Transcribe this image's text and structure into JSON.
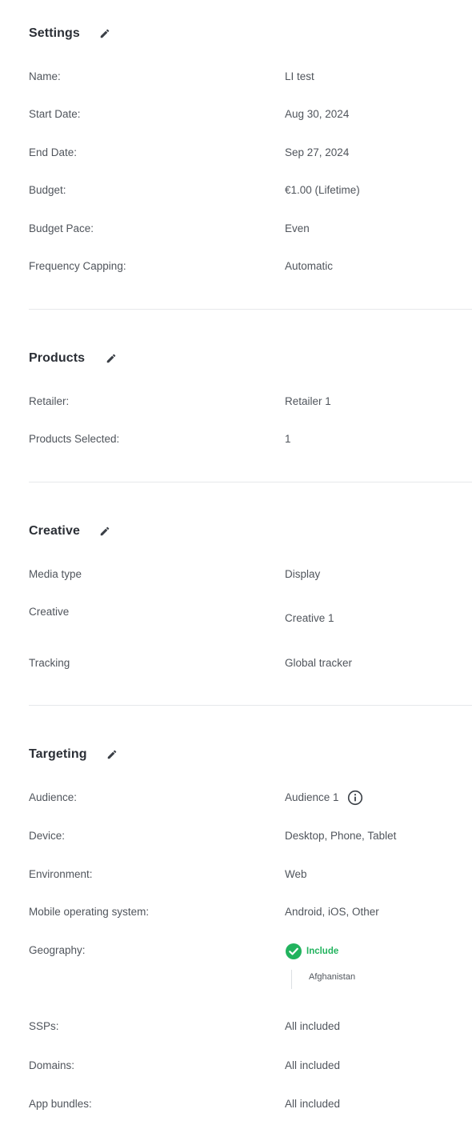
{
  "settings": {
    "title": "Settings",
    "rows": [
      {
        "label": "Name:",
        "value": "LI test"
      },
      {
        "label": "Start Date:",
        "value": "Aug 30, 2024"
      },
      {
        "label": "End Date:",
        "value": "Sep 27, 2024"
      },
      {
        "label": "Budget:",
        "value": "€1.00 (Lifetime)"
      },
      {
        "label": "Budget Pace:",
        "value": "Even"
      },
      {
        "label": "Frequency Capping:",
        "value": "Automatic"
      }
    ]
  },
  "products": {
    "title": "Products",
    "rows": [
      {
        "label": "Retailer:",
        "value": "Retailer 1"
      },
      {
        "label": "Products Selected:",
        "value": "1"
      }
    ]
  },
  "creative": {
    "title": "Creative",
    "rows": [
      {
        "label": "Media type",
        "value": "Display"
      },
      {
        "label": "Creative",
        "value": "Creative 1"
      },
      {
        "label": "Tracking",
        "value": "Global tracker"
      }
    ]
  },
  "targeting": {
    "title": "Targeting",
    "rows": [
      {
        "label": "Audience:",
        "value": "Audience 1"
      },
      {
        "label": "Device:",
        "value": "Desktop, Phone, Tablet"
      },
      {
        "label": "Environment:",
        "value": "Web"
      },
      {
        "label": "Mobile operating system:",
        "value": "Android, iOS, Other"
      },
      {
        "label": "Geography:",
        "value": ""
      },
      {
        "label": "SSPs:",
        "value": "All included"
      },
      {
        "label": "Domains:",
        "value": "All included"
      },
      {
        "label": "App bundles:",
        "value": "All included"
      }
    ],
    "geography": {
      "include_label": "Include",
      "countries": [
        "Afghanistan"
      ]
    }
  },
  "icons": {
    "edit": "pencil-icon",
    "info": "info-circle-icon",
    "include": "check-circle-icon"
  },
  "colors": {
    "include_green": "#22b35e",
    "divider": "#e6e8eb",
    "heading": "#2b2f36"
  }
}
